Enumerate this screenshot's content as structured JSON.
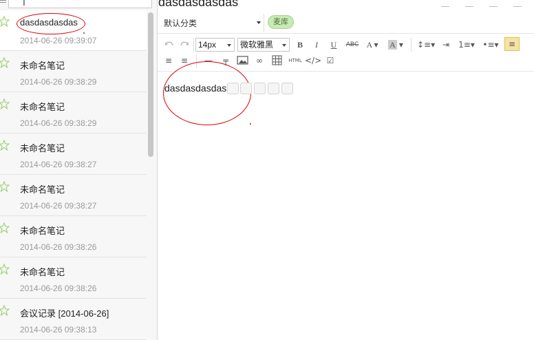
{
  "search": {
    "placeholder": ""
  },
  "notes": [
    {
      "title": "dasdasdasdas",
      "date": "2014-06-26 09:39:07"
    },
    {
      "title": "未命名笔记",
      "date": "2014-06-26 09:38:29"
    },
    {
      "title": "未命名笔记",
      "date": "2014-06-26 09:38:29"
    },
    {
      "title": "未命名笔记",
      "date": "2014-06-26 09:38:27"
    },
    {
      "title": "未命名笔记",
      "date": "2014-06-26 09:38:27"
    },
    {
      "title": "未命名笔记",
      "date": "2014-06-26 09:38:26"
    },
    {
      "title": "未命名笔记",
      "date": "2014-06-26 09:38:26"
    },
    {
      "title": "会议记录 [2014-06-26]",
      "date": "2014-06-26 09:38:13"
    }
  ],
  "editor": {
    "title": "dasdasdasdas",
    "category": "默认分类",
    "tag": "麦库",
    "font_size": "14px",
    "font_family": "微软雅黑",
    "html_label": "HTML",
    "strike_label": "ABC",
    "content": "dasdasdasdas"
  },
  "colors": {
    "accent_red": "#dd0000",
    "tag_green": "#c9e9b6",
    "star_green": "#9ccf6f"
  }
}
